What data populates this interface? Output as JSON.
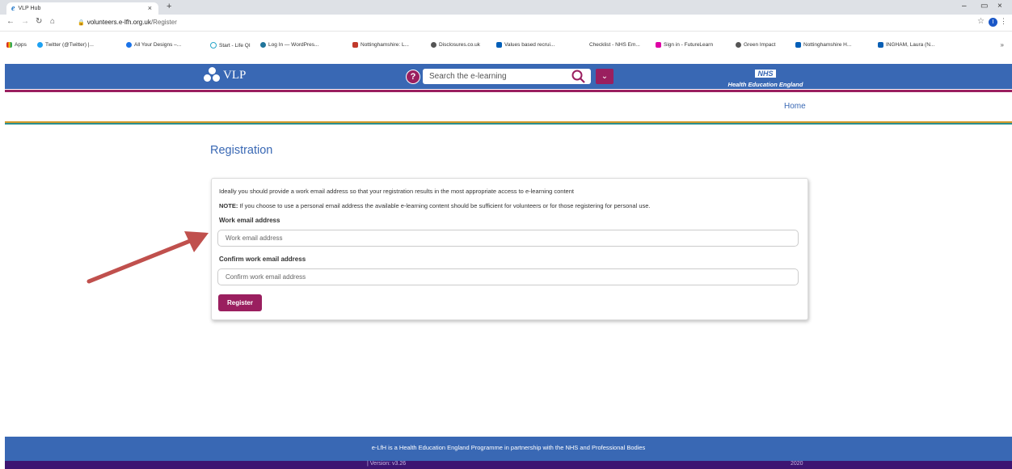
{
  "browser": {
    "tab_title": "VLP Hub",
    "tab_close": "×",
    "new_tab": "+",
    "url_domain": "volunteers.e-lfh.org.uk",
    "url_path": "/Register",
    "profile_initial": "I",
    "window_controls": [
      "–",
      "▭",
      "×"
    ]
  },
  "bookmarks": [
    {
      "label": "Apps",
      "color": "#d93025"
    },
    {
      "label": "Twitter (@Twitter) |...",
      "color": "#1da1f2"
    },
    {
      "label": "All Your Designs –...",
      "color": "#1a73e8"
    },
    {
      "label": "Start - Life QI",
      "color": "#2aa7c9"
    },
    {
      "label": "Log In — WordPres...",
      "color": "#21759b"
    },
    {
      "label": "Nottinghamshire: L...",
      "color": "#c0392b"
    },
    {
      "label": "Disclosures.co.uk",
      "color": "#555555"
    },
    {
      "label": "Values based recrui...",
      "color": "#005eb8"
    },
    {
      "label": "Checklist - NHS Em...",
      "color": "#ffffff"
    },
    {
      "label": "Sign in - FutureLearn",
      "color": "#de00a5"
    },
    {
      "label": "Green Impact",
      "color": "#555555"
    },
    {
      "label": "Nottinghamshire H...",
      "color": "#005eb8"
    },
    {
      "label": "INGHAM, Laura (N...",
      "color": "#0a5fb4"
    }
  ],
  "bookmarks_more": "»",
  "header": {
    "logo_text": "VLP",
    "help_glyph": "?",
    "search_placeholder": "Search the e-learning",
    "dropdown_glyph": "⌄",
    "nhs_badge": "NHS",
    "nhs_org": "Health Education England"
  },
  "subnav": {
    "home": "Home"
  },
  "main": {
    "title": "Registration",
    "intro": "Ideally you should provide a work email address so that your registration results in the most appropriate access to e-learning content",
    "note_label": "NOTE:",
    "note_text": " If you choose to use a personal email address the available e-learning content should be sufficient for volunteers or for those registering for personal use.",
    "email_label": "Work email address",
    "email_placeholder": "Work email address",
    "email_value": "",
    "confirm_label": "Confirm work email address",
    "confirm_placeholder": "Confirm work email address",
    "confirm_value": "",
    "register_label": "Register"
  },
  "footer": {
    "text": "e-LfH is a Health Education England Programme in partnership with the NHS and Professional Bodies",
    "version": "| Version: v3.26",
    "year": "2020"
  },
  "colors": {
    "brand_blue": "#3968b4",
    "brand_magenta": "#9a1f5f",
    "footer_purple": "#3d1572",
    "annotation_arrow": "#c0504d"
  }
}
